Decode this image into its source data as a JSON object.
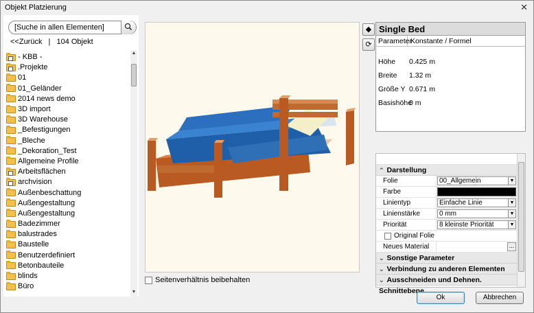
{
  "window": {
    "title": "Objekt Platzierung"
  },
  "search": {
    "placeholder": "[Suche in allen Elementen]"
  },
  "nav": {
    "back": "<<Zurück",
    "separator": "|",
    "count": "104 Objekt"
  },
  "tree": [
    {
      "label": "- KBB -",
      "icon": "folder-link-icon"
    },
    {
      "label": ".Projekte",
      "icon": "folder-link-icon"
    },
    {
      "label": "01",
      "icon": "folder-icon"
    },
    {
      "label": "01_Geländer",
      "icon": "folder-icon"
    },
    {
      "label": "2014 news demo",
      "icon": "folder-icon"
    },
    {
      "label": "3D import",
      "icon": "folder-icon"
    },
    {
      "label": "3D Warehouse",
      "icon": "folder-icon"
    },
    {
      "label": "_Befestigungen",
      "icon": "folder-icon"
    },
    {
      "label": "_Bleche",
      "icon": "folder-icon"
    },
    {
      "label": "_Dekoration_Test",
      "icon": "folder-icon"
    },
    {
      "label": "Allgemeine Profile",
      "icon": "folder-icon"
    },
    {
      "label": "Arbeitsflächen",
      "icon": "folder-link-icon"
    },
    {
      "label": "archvision",
      "icon": "folder-link-icon"
    },
    {
      "label": "Außenbeschattung",
      "icon": "folder-icon"
    },
    {
      "label": "Außengestaltung",
      "icon": "folder-icon"
    },
    {
      "label": "Außengestaltung",
      "icon": "folder-icon"
    },
    {
      "label": "Badezimmer",
      "icon": "folder-icon"
    },
    {
      "label": "balustrades",
      "icon": "folder-icon"
    },
    {
      "label": "Baustelle",
      "icon": "folder-icon"
    },
    {
      "label": "Benutzerdefiniert",
      "icon": "folder-icon"
    },
    {
      "label": "Betonbauteile",
      "icon": "folder-icon"
    },
    {
      "label": "blinds",
      "icon": "folder-icon"
    },
    {
      "label": "Büro",
      "icon": "folder-icon"
    }
  ],
  "preview": {
    "aspect_label": "Seitenverhältnis beibehalten"
  },
  "params": {
    "title": "Single Bed",
    "col_param": "Parameter",
    "col_value": "Konstante / Formel",
    "rows": [
      {
        "name": "Höhe",
        "value": "0.425 m"
      },
      {
        "name": "Breite",
        "value": "1.32 m"
      },
      {
        "name": "Größe Y",
        "value": "0.671 m"
      },
      {
        "name": "Basishöhe",
        "value": "0 m"
      }
    ]
  },
  "props": {
    "section_darstellung": "Darstellung",
    "folie_label": "Folie",
    "folie_value": "00_Allgemein",
    "farbe_label": "Farbe",
    "farbe_color": "#000000",
    "linientyp_label": "Linientyp",
    "linientyp_value": "Einfache Linie",
    "linienstaerke_label": "Linienstärke",
    "linienstaerke_value": "0 mm",
    "prioritaet_label": "Priorität",
    "prioritaet_value": "8 kleinste Priorität",
    "original_folie": "Original Folie",
    "neues_material": "Neues Material",
    "ellipsis": "...",
    "section_sonstige": "Sonstige Parameter",
    "section_verbindung": "Verbindung zu anderen Elementen",
    "section_ausschneiden": "Ausschneiden und Dehnen. Schnittebene"
  },
  "buttons": {
    "ok": "Ok",
    "cancel": "Abbrechen"
  }
}
